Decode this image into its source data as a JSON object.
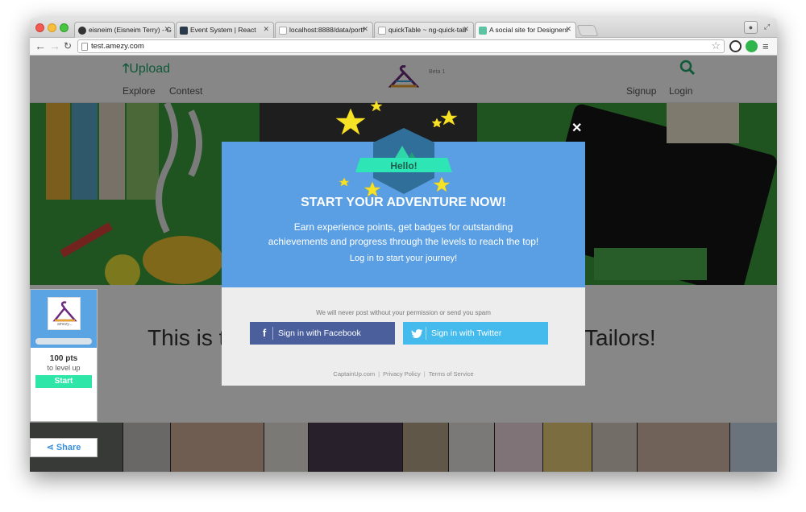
{
  "browser": {
    "tabs": [
      {
        "title": "eisneim (Eisneim Terry) - G",
        "favicon_color": "#333333"
      },
      {
        "title": "Event System | React",
        "favicon_color": "#2b3a4a"
      },
      {
        "title": "localhost:8888/data/portf",
        "favicon_color": "#dddddd"
      },
      {
        "title": "quickTable ~ ng-quick-tab",
        "favicon_color": "#dddddd"
      },
      {
        "title": "A social site for Designers",
        "favicon_color": "#5ec3a2"
      }
    ],
    "url": "test.amezy.com"
  },
  "site": {
    "upload_label": "Upload",
    "beta_label": "Beta 1",
    "nav_left": [
      "Explore",
      "Contest"
    ],
    "nav_right": [
      "Signup",
      "Login"
    ],
    "tagline_left": "This is t",
    "tagline_right": "Tailors!",
    "accent_color": "#1ea86b"
  },
  "widget": {
    "logo_text": "amezy...",
    "points": "100 pts",
    "points_sub": "to level up",
    "start_label": "Start",
    "share_label": "Share"
  },
  "modal": {
    "badge_label": "Hello!",
    "title": "START YOUR ADVENTURE NOW!",
    "body_line1": "Earn experience points, get badges for outstanding",
    "body_line2": "achievements and progress through the levels to reach the top!",
    "login_prompt": "Log in to start your journey!",
    "note": "We will never post without your permission or send you spam",
    "facebook_label": "Sign in with Facebook",
    "twitter_label": "Sign in with Twitter",
    "footer_links": [
      "CaptainUp.com",
      "Privacy Policy",
      "Terms of Service"
    ],
    "close_symbol": "✕",
    "colors": {
      "header": "#5a9fe3",
      "facebook": "#4a5f9c",
      "twitter": "#44bbec",
      "badge_ribbon": "#2ee6b5"
    }
  }
}
